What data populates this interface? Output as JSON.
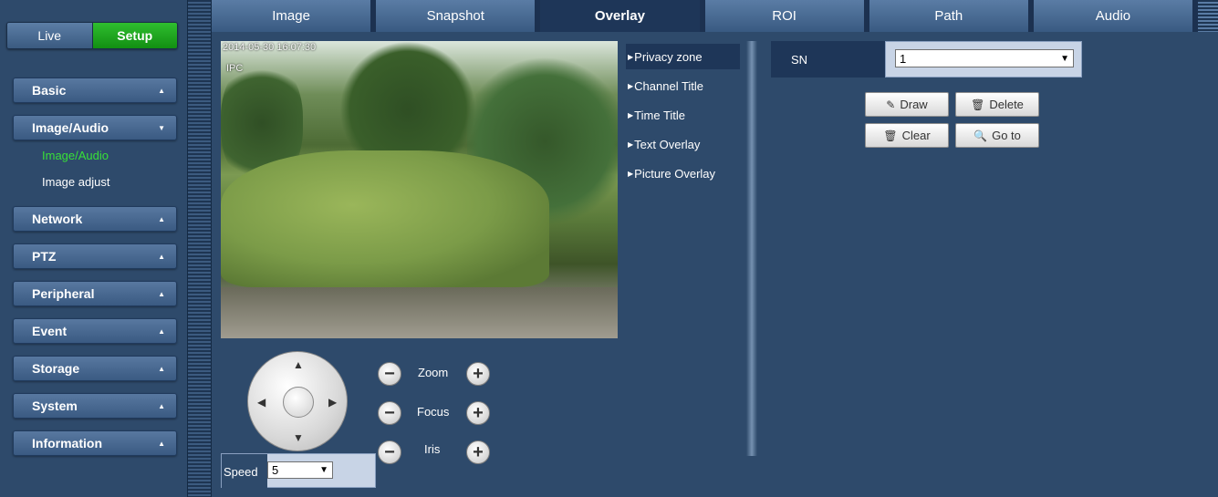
{
  "mode_tabs": {
    "live": "Live",
    "setup": "Setup"
  },
  "sidebar": {
    "items": [
      {
        "label": "Basic"
      },
      {
        "label": "Image/Audio"
      },
      {
        "label": "Network"
      },
      {
        "label": "PTZ"
      },
      {
        "label": "Peripheral"
      },
      {
        "label": "Event"
      },
      {
        "label": "Storage"
      },
      {
        "label": "System"
      },
      {
        "label": "Information"
      }
    ],
    "submenu": [
      {
        "label": "Image/Audio",
        "active": true
      },
      {
        "label": "Image adjust",
        "active": false
      }
    ]
  },
  "tabs": [
    "Image",
    "Snapshot",
    "Overlay",
    "ROI",
    "Path",
    "Audio"
  ],
  "active_tab": "Overlay",
  "video": {
    "timestamp": "2014-05-30 16:07:30",
    "channel_title": "IPC"
  },
  "ptz": {
    "zoom_label": "Zoom",
    "focus_label": "Focus",
    "iris_label": "Iris",
    "speed_label": "Speed",
    "speed_value": "5"
  },
  "overlay_menu": [
    "Privacy zone",
    "Channel Title",
    "Time Title",
    "Text Overlay",
    "Picture Overlay"
  ],
  "privacy_zone": {
    "sn_label": "SN",
    "sn_value": "1",
    "buttons": {
      "draw": "Draw",
      "delete": "Delete",
      "clear": "Clear",
      "goto": "Go to"
    }
  },
  "colors": {
    "background": "#2e4a6b",
    "active_tab": "#1e3658",
    "setup_green": "#1fa81f",
    "active_submenu": "#38e038"
  }
}
